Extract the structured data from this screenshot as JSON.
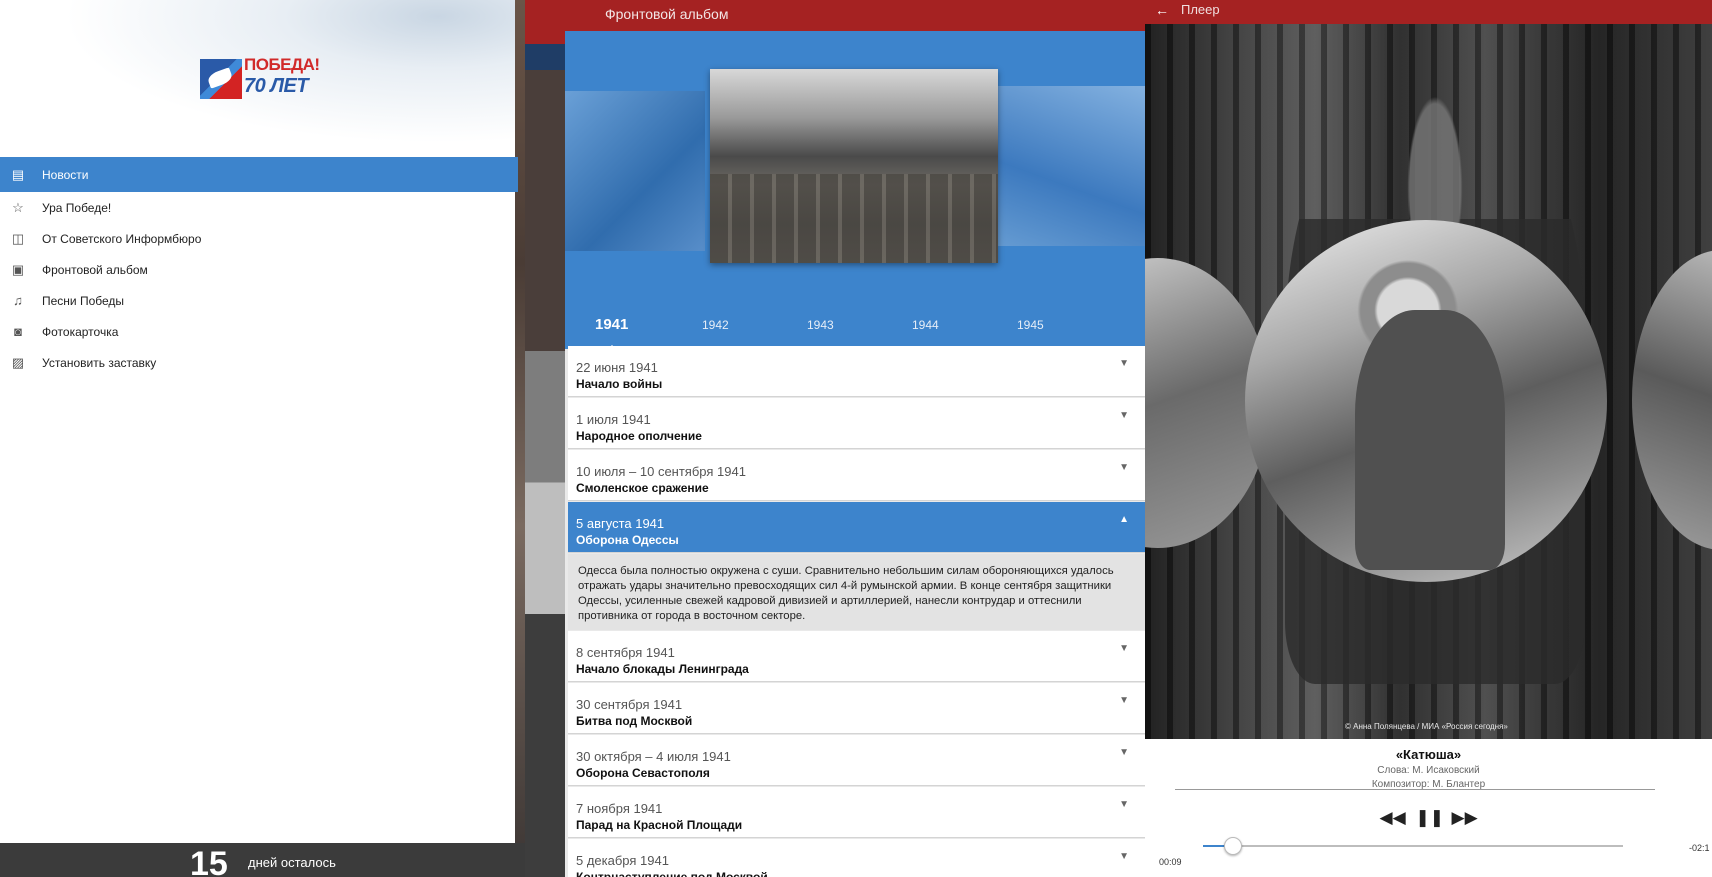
{
  "drawer": {
    "logo": {
      "line1": "ПОБЕДА!",
      "line2": "70 ЛЕТ"
    },
    "items": [
      {
        "label": "Новости",
        "icon": "document-icon",
        "active": true
      },
      {
        "label": "Ура Победе!",
        "icon": "star-trophy-icon",
        "active": false
      },
      {
        "label": "От Советского Информбюро",
        "icon": "radio-icon",
        "active": false
      },
      {
        "label": "Фронтовой альбом",
        "icon": "album-icon",
        "active": false
      },
      {
        "label": "Песни Победы",
        "icon": "gramophone-icon",
        "active": false
      },
      {
        "label": "Фотокарточка",
        "icon": "camera-icon",
        "active": false
      },
      {
        "label": "Установить заставку",
        "icon": "wallpaper-icon",
        "active": false
      }
    ],
    "countdown": {
      "number": "15",
      "label": "дней осталось"
    }
  },
  "album": {
    "title": "Фронтовой альбом",
    "years": [
      "1941",
      "1942",
      "1943",
      "1944",
      "1945"
    ],
    "selected_year": "1941",
    "events": [
      {
        "date": "22 июня 1941",
        "title": "Начало войны",
        "expanded": false
      },
      {
        "date": "1 июля 1941",
        "title": "Народное ополчение",
        "expanded": false
      },
      {
        "date": "10 июля – 10 сентября 1941",
        "title": "Смоленское сражение",
        "expanded": false
      },
      {
        "date": "5 августа 1941",
        "title": "Оборона Одессы",
        "expanded": true,
        "description": "Одесса была полностью окружена с суши. Сравнительно небольшим силам обороняющихся удалось отражать удары значительно превосходящих сил 4-й румынской армии. В конце сентября защитники Одессы, усиленные свежей кадровой дивизией и артиллерией, нанесли контрудар и оттеснили противника от города в восточном секторе."
      },
      {
        "date": "8 сентября 1941",
        "title": "Начало блокады Ленинграда",
        "expanded": false
      },
      {
        "date": "30 сентября 1941",
        "title": "Битва под Москвой",
        "expanded": false
      },
      {
        "date": "30 октября – 4 июля 1941",
        "title": "Оборона Севастополя",
        "expanded": false
      },
      {
        "date": "7 ноября 1941",
        "title": "Парад на Красной Площади",
        "expanded": false
      },
      {
        "date": "5 декабря 1941",
        "title": "Контрнаступление под Москвой",
        "expanded": false
      }
    ]
  },
  "player": {
    "title": "Плеер",
    "credit": "© Анна Полянцева / МИА «Россия сегодня»",
    "song": "«Катюша»",
    "words": "Слова: М. Исаковский",
    "composer": "Композитор: М. Блантер",
    "time_current": "00:09",
    "time_remaining": "-02:1",
    "progress": 0.07
  },
  "colors": {
    "accent_blue": "#3d84cc",
    "header_red": "#a52222"
  }
}
